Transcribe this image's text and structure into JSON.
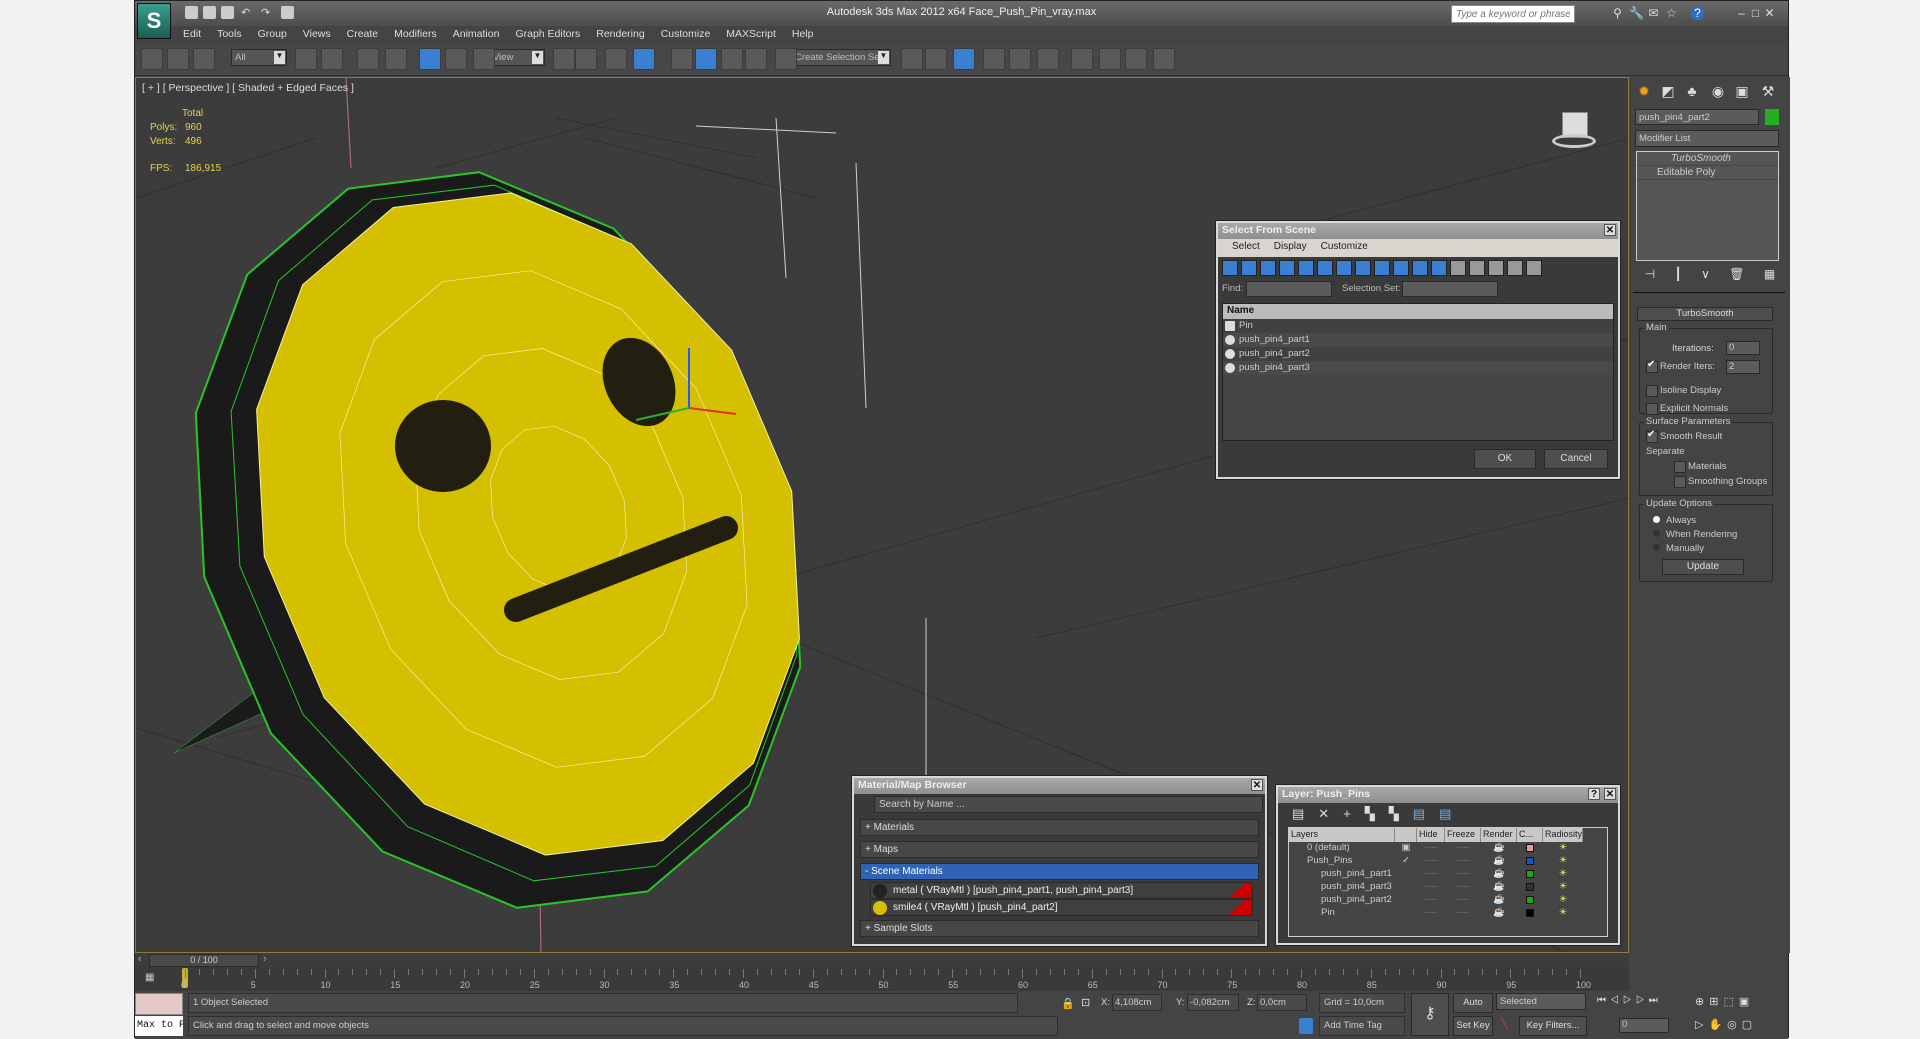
{
  "app": {
    "title": "Autodesk 3ds Max  2012 x64    Face_Push_Pin_vray.max",
    "search_placeholder": "Type a keyword or phrase",
    "accent": "#3a7fd1"
  },
  "menu": [
    "Edit",
    "Tools",
    "Group",
    "Views",
    "Create",
    "Modifiers",
    "Animation",
    "Graph Editors",
    "Rendering",
    "Customize",
    "MAXScript",
    "Help"
  ],
  "toolbar": {
    "selection_filter": "All",
    "ref_coord": "View",
    "selection_set": "Create Selection Se",
    "icons": [
      "select-and-link-icon",
      "unlink-icon",
      "bind-space-warp-icon",
      "select-object-icon",
      "select-by-name-icon",
      "rect-selection-icon",
      "window-crossing-icon",
      "select-move-icon",
      "select-rotate-icon",
      "select-scale-icon",
      "mirror-icon",
      "pivot-icon",
      "manipulate-icon",
      "keyboard-shortcut-icon",
      "snap-3d-icon",
      "angle-snap-icon",
      "percent-snap-icon",
      "spinner-snap-icon",
      "edit-named-sets-icon",
      "mirror-icon",
      "align-icon",
      "layer-manager-icon",
      "graphite-icon",
      "curve-editor-icon",
      "schematic-view-icon",
      "material-editor-icon",
      "render-setup-icon",
      "rendered-frame-icon",
      "render-icon"
    ]
  },
  "viewport": {
    "label": "[ + ] [ Perspective ] [ Shaded + Edged Faces ]",
    "stats": {
      "total_label": "Total",
      "polys_label": "Polys:",
      "polys": "960",
      "verts_label": "Verts:",
      "verts": "496",
      "fps_label": "FPS:",
      "fps": "186,915"
    },
    "colors": {
      "face": "#d4c000",
      "rim": "#1a1a1a",
      "wire": "#29c42a"
    }
  },
  "command_panel": {
    "object_name": "push_pin4_part2",
    "object_color": "#22b022",
    "modifier_list": "Modifier List",
    "stack": [
      "TurboSmooth",
      "Editable Poly"
    ],
    "rollout": {
      "title": "TurboSmooth",
      "main": "Main",
      "iterations_label": "Iterations:",
      "iterations": "0",
      "render_iters_label": "Render Iters:",
      "render_iters": "2",
      "render_iters_checked": true,
      "isoline": "Isoline Display",
      "explicit_normals": "Explicit Normals",
      "surface": "Surface Parameters",
      "smooth_result": "Smooth Result",
      "separate": "Separate",
      "materials": "Materials",
      "smoothing_groups": "Smoothing Groups",
      "update_options": "Update Options",
      "always": "Always",
      "when_rendering": "When Rendering",
      "manually": "Manually",
      "update": "Update"
    }
  },
  "select_dialog": {
    "title": "Select From Scene",
    "menu": [
      "Select",
      "Display",
      "Customize"
    ],
    "find_label": "Find:",
    "find_value": "",
    "selection_set_label": "Selection Set:",
    "column": "Name",
    "items": [
      "Pin",
      "push_pin4_part1",
      "push_pin4_part2",
      "push_pin4_part3"
    ],
    "ok": "OK",
    "cancel": "Cancel"
  },
  "material_browser": {
    "title": "Material/Map Browser",
    "search_placeholder": "Search by Name ...",
    "sections": [
      "+ Materials",
      "+ Maps",
      "- Scene Materials",
      "+ Sample Slots"
    ],
    "scene_materials": [
      "metal  ( VRayMtl ) [push_pin4_part1, push_pin4_part3]",
      "smile4  ( VRayMtl ) [push_pin4_part2]"
    ]
  },
  "layer_dialog": {
    "title": "Layer: Push_Pins",
    "columns": [
      "Layers",
      "",
      "Hide",
      "Freeze",
      "Render",
      "C...",
      "Radiosity"
    ],
    "rows": [
      {
        "name": "0 (default)",
        "indent": 1,
        "color": "#e89a9a",
        "active": "box"
      },
      {
        "name": "Push_Pins",
        "indent": 1,
        "color": "#1a55c8",
        "active": "check"
      },
      {
        "name": "push_pin4_part1",
        "indent": 2,
        "color": "#1aa81a"
      },
      {
        "name": "push_pin4_part3",
        "indent": 2,
        "color": "#333333"
      },
      {
        "name": "push_pin4_part2",
        "indent": 2,
        "color": "#1aa81a"
      },
      {
        "name": "Pin",
        "indent": 2,
        "color": "#000000"
      }
    ],
    "dash": "----"
  },
  "timeline": {
    "frame": "0 / 100",
    "ticks": [
      "0",
      "5",
      "10",
      "15",
      "20",
      "25",
      "30",
      "35",
      "40",
      "45",
      "50",
      "55",
      "60",
      "65",
      "70",
      "75",
      "80",
      "85",
      "90",
      "95",
      "100"
    ]
  },
  "status": {
    "maxscript": "Max to Physc",
    "selected": "1 Object Selected",
    "prompt": "Click and drag to select and move objects",
    "x_label": "X:",
    "x": "4,108cm",
    "y_label": "Y:",
    "y": "-0,082cm",
    "z_label": "Z:",
    "z": "0,0cm",
    "grid": "Grid = 10,0cm",
    "add_time_tag": "Add Time Tag",
    "auto_key": "Auto Key",
    "set_key": "Set Key",
    "key_mode": "Selected",
    "key_filters": "Key Filters...",
    "current_frame": "0"
  }
}
